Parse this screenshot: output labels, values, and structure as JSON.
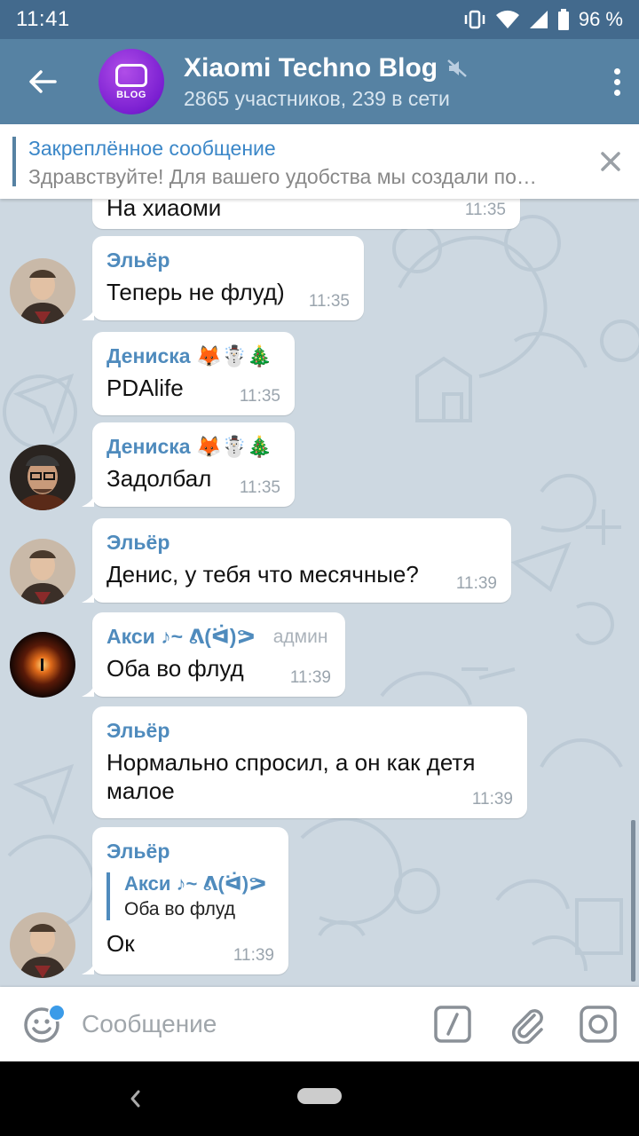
{
  "status": {
    "time": "11:41",
    "battery": "96 %"
  },
  "header": {
    "title": "Xiaomi Techno Blog",
    "subtitle": "2865 участников, 239 в сети",
    "avatar_label": "BLOG"
  },
  "pinned": {
    "heading": "Закреплённое сообщение",
    "preview": "Здравствуйте! Для вашего удобства мы создали по…"
  },
  "messages": [
    {
      "text": "На хиаоми",
      "time": "11:35"
    },
    {
      "author": "Эльёр",
      "text": "Теперь не флуд)",
      "time": "11:35"
    },
    {
      "author": "Дениска 🦊☃️🎄",
      "text": "PDAlife",
      "time": "11:35"
    },
    {
      "author": "Дениска 🦊☃️🎄",
      "text": "Задолбал",
      "time": "11:35"
    },
    {
      "author": "Эльёр",
      "text": "Денис, у тебя что месячные?",
      "time": "11:39"
    },
    {
      "author": "Акси ♪~ ᕕ(ᐛ)ᕗ",
      "role": "админ",
      "text": "Оба во флуд",
      "time": "11:39"
    },
    {
      "author": "Эльёр",
      "text": "Нормально спросил, а он как детя малое",
      "time": "11:39"
    },
    {
      "author": "Эльёр",
      "reply_author": "Акси ♪~ ᕕ(ᐛ)ᕗ",
      "reply_text": "Оба во флуд",
      "text": "Ок",
      "time": "11:39"
    }
  ],
  "input": {
    "placeholder": "Сообщение"
  }
}
